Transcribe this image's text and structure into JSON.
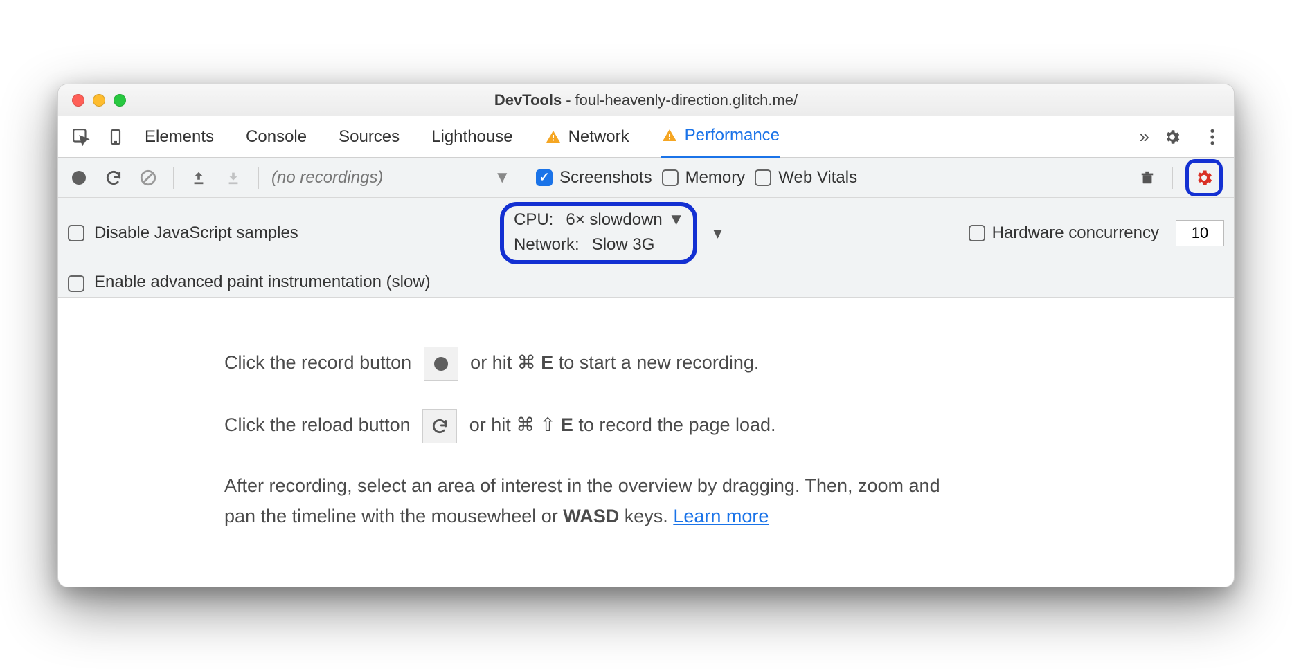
{
  "window": {
    "title_prefix": "DevTools",
    "title_separator": " - ",
    "title_url": "foul-heavenly-direction.glitch.me/"
  },
  "tabs": {
    "items": [
      "Elements",
      "Console",
      "Sources",
      "Lighthouse",
      "Network",
      "Performance"
    ],
    "active": "Performance",
    "moreGlyph": "»"
  },
  "toolbar": {
    "recordings_label": "(no recordings)",
    "screenshots_label": "Screenshots",
    "memory_label": "Memory",
    "webvitals_label": "Web Vitals"
  },
  "settings": {
    "disable_js_label": "Disable JavaScript samples",
    "advanced_paint_label": "Enable advanced paint instrumentation (slow)",
    "cpu_label": "CPU:",
    "cpu_value": "6× slowdown",
    "network_label": "Network:",
    "network_value": "Slow 3G",
    "hw_label": "Hardware concurrency",
    "hw_value": "10"
  },
  "content": {
    "line1_a": "Click the record button",
    "line1_b": "or hit ⌘ ",
    "line1_key": "E",
    "line1_c": " to start a new recording.",
    "line2_a": "Click the reload button",
    "line2_b": "or hit ⌘ ⇧ ",
    "line2_key": "E",
    "line2_c": " to record the page load.",
    "line3": "After recording, select an area of interest in the overview by dragging. Then, zoom and pan the timeline with the mousewheel or ",
    "line3_kb": "WASD",
    "line3_c": " keys. ",
    "learn_more": "Learn more"
  }
}
